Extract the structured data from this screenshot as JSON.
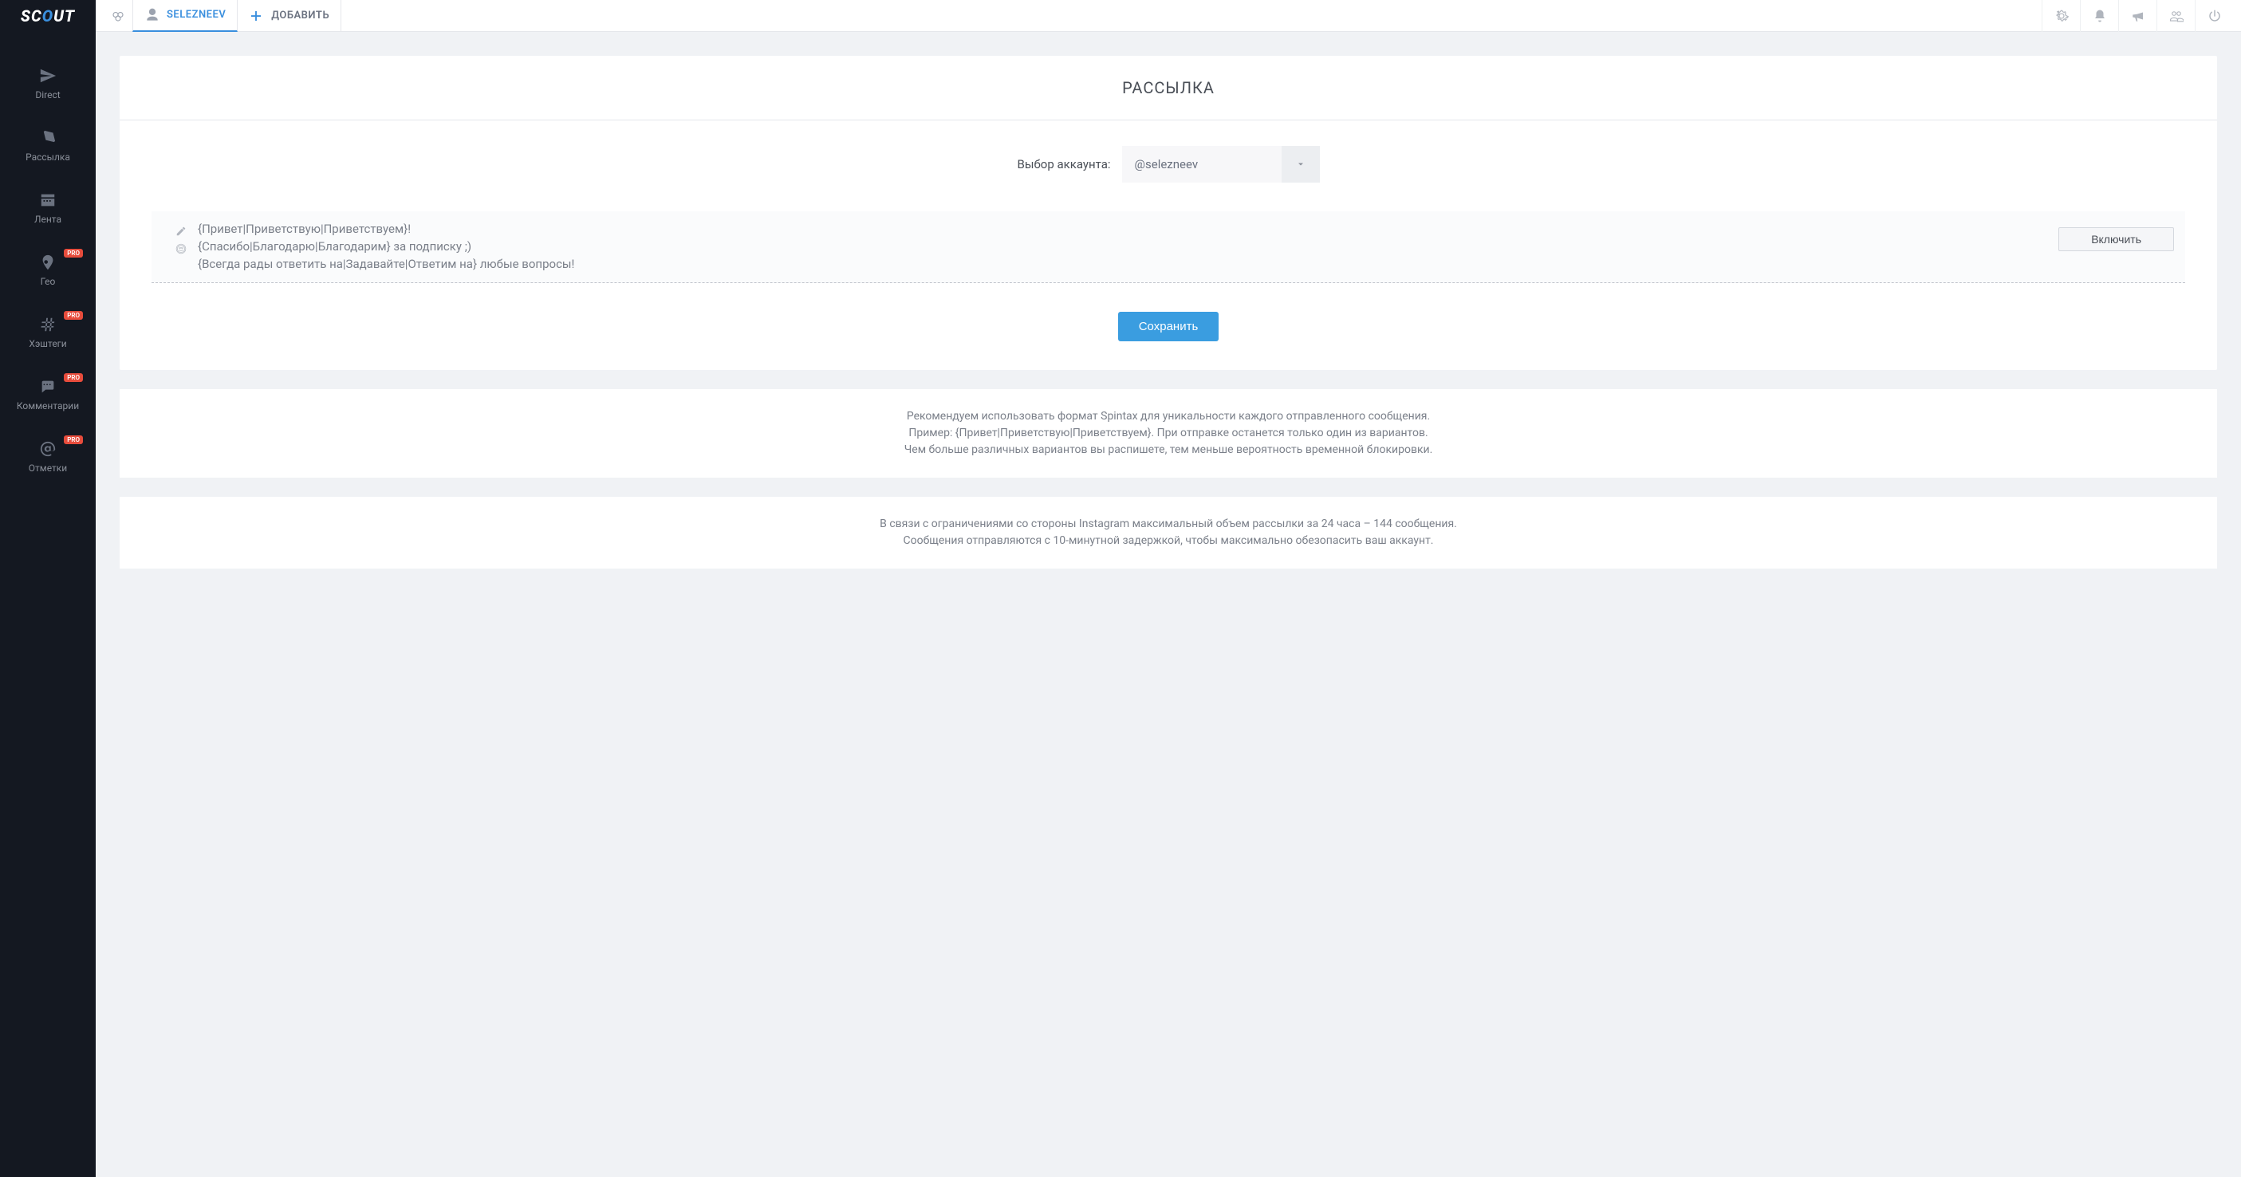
{
  "brand": {
    "full": "SCOUT"
  },
  "sidebar": {
    "items": [
      {
        "label": "Direct",
        "badge": null
      },
      {
        "label": "Рассылка",
        "badge": null
      },
      {
        "label": "Лента",
        "badge": null
      },
      {
        "label": "Гео",
        "badge": "PRO"
      },
      {
        "label": "Хэштеги",
        "badge": "PRO"
      },
      {
        "label": "Комментарии",
        "badge": "PRO"
      },
      {
        "label": "Отметки",
        "badge": "PRO"
      }
    ]
  },
  "topbar": {
    "active_tab": "SELEZNEEV",
    "add_label": "ДОБАВИТЬ"
  },
  "page": {
    "title": "РАССЫЛКА",
    "account_label": "Выбор аккаунта:",
    "account_selected": "@selezneev",
    "message_text": "{Привет|Приветствую|Приветствуем}!\n{Спасибо|Благодарю|Благодарим} за подписку ;)\n{Всегда рады ответить на|Задавайте|Ответим на} любые вопросы!",
    "enable_button": "Включить",
    "save_button": "Сохранить",
    "hint1_line1": "Рекомендуем использовать формат Spintax для уникальности каждого отправленного сообщения.",
    "hint1_line2": "Пример: {Привет|Приветствую|Приветствуем}. При отправке останется только один из вариантов.",
    "hint1_line3": "Чем больше различных вариантов вы распишете, тем меньше вероятность временной блокировки.",
    "hint2_line1": "В связи с ограничениями со стороны Instagram максимальный объем рассылки за 24 часа – 144 сообщения.",
    "hint2_line2": "Сообщения отправляются с 10-минутной задержкой, чтобы максимально обезопасить ваш аккаунт."
  }
}
